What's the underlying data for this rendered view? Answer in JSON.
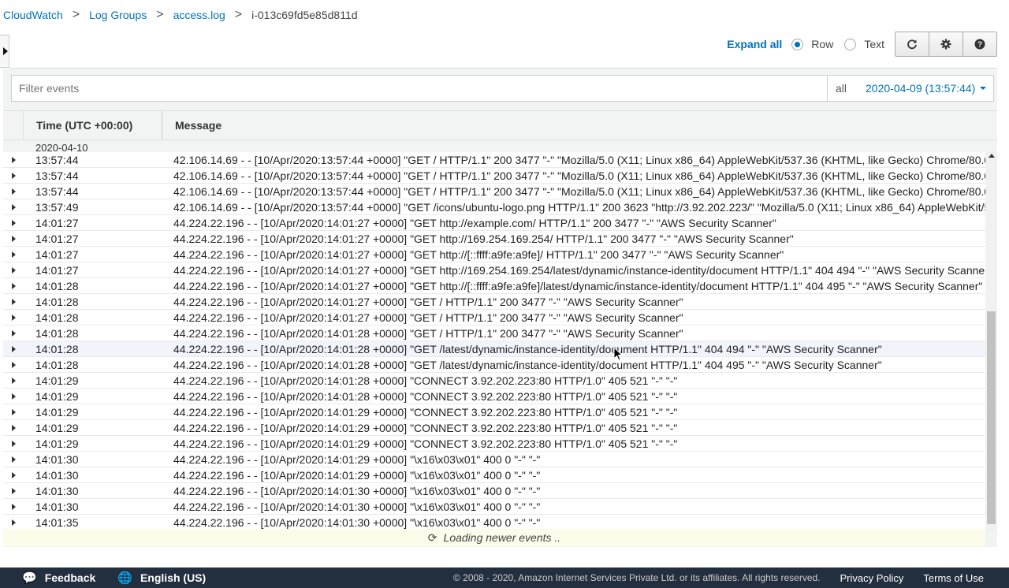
{
  "breadcrumb": {
    "items": [
      "CloudWatch",
      "Log Groups",
      "access.log"
    ],
    "current": "i-013c69fd5e85d811d",
    "separator": ">"
  },
  "toolbar": {
    "expand_all": "Expand all",
    "view_options": [
      "Row",
      "Text"
    ],
    "selected_view": "Row",
    "buttons": [
      "refresh-icon",
      "gear-icon",
      "help-icon"
    ]
  },
  "filter": {
    "placeholder": "Filter events",
    "range_label": "all",
    "range_date": "2020-04-09 (13:57:44)"
  },
  "table": {
    "col_time": "Time (UTC +00:00)",
    "col_message": "Message",
    "date_group": "2020-04-10",
    "rows": [
      {
        "time": "13:57:44",
        "message": "42.106.14.69 - - [10/Apr/2020:13:57:44 +0000] \"GET / HTTP/1.1\" 200 3477 \"-\" \"Mozilla/5.0 (X11; Linux x86_64) AppleWebKit/537.36 (KHTML, like Gecko) Chrome/80.0"
      },
      {
        "time": "13:57:44",
        "message": "42.106.14.69 - - [10/Apr/2020:13:57:44 +0000] \"GET / HTTP/1.1\" 200 3477 \"-\" \"Mozilla/5.0 (X11; Linux x86_64) AppleWebKit/537.36 (KHTML, like Gecko) Chrome/80.0"
      },
      {
        "time": "13:57:44",
        "message": "42.106.14.69 - - [10/Apr/2020:13:57:44 +0000] \"GET / HTTP/1.1\" 200 3477 \"-\" \"Mozilla/5.0 (X11; Linux x86_64) AppleWebKit/537.36 (KHTML, like Gecko) Chrome/80.0"
      },
      {
        "time": "13:57:49",
        "message": "42.106.14.69 - - [10/Apr/2020:13:57:44 +0000] \"GET /icons/ubuntu-logo.png HTTP/1.1\" 200 3623 \"http://3.92.202.223/\" \"Mozilla/5.0 (X11; Linux x86_64) AppleWebKit/5"
      },
      {
        "time": "14:01:27",
        "message": "44.224.22.196 - - [10/Apr/2020:14:01:27 +0000] \"GET http://example.com/ HTTP/1.1\" 200 3477 \"-\" \"AWS Security Scanner\""
      },
      {
        "time": "14:01:27",
        "message": "44.224.22.196 - - [10/Apr/2020:14:01:27 +0000] \"GET http://169.254.169.254/ HTTP/1.1\" 200 3477 \"-\" \"AWS Security Scanner\""
      },
      {
        "time": "14:01:27",
        "message": "44.224.22.196 - - [10/Apr/2020:14:01:27 +0000] \"GET http://[::ffff:a9fe:a9fe]/ HTTP/1.1\" 200 3477 \"-\" \"AWS Security Scanner\""
      },
      {
        "time": "14:01:27",
        "message": "44.224.22.196 - - [10/Apr/2020:14:01:27 +0000] \"GET http://169.254.169.254/latest/dynamic/instance-identity/document HTTP/1.1\" 404 494 \"-\" \"AWS Security Scanne"
      },
      {
        "time": "14:01:28",
        "message": "44.224.22.196 - - [10/Apr/2020:14:01:27 +0000] \"GET http://[::ffff:a9fe:a9fe]/latest/dynamic/instance-identity/document HTTP/1.1\" 404 495 \"-\" \"AWS Security Scanner\""
      },
      {
        "time": "14:01:28",
        "message": "44.224.22.196 - - [10/Apr/2020:14:01:27 +0000] \"GET / HTTP/1.1\" 200 3477 \"-\" \"AWS Security Scanner\""
      },
      {
        "time": "14:01:28",
        "message": "44.224.22.196 - - [10/Apr/2020:14:01:27 +0000] \"GET / HTTP/1.1\" 200 3477 \"-\" \"AWS Security Scanner\""
      },
      {
        "time": "14:01:28",
        "message": "44.224.22.196 - - [10/Apr/2020:14:01:28 +0000] \"GET / HTTP/1.1\" 200 3477 \"-\" \"AWS Security Scanner\""
      },
      {
        "time": "14:01:28",
        "message": "44.224.22.196 - - [10/Apr/2020:14:01:28 +0000] \"GET /latest/dynamic/instance-identity/document HTTP/1.1\" 404 494 \"-\" \"AWS Security Scanner\""
      },
      {
        "time": "14:01:28",
        "message": "44.224.22.196 - - [10/Apr/2020:14:01:28 +0000] \"GET /latest/dynamic/instance-identity/document HTTP/1.1\" 404 495 \"-\" \"AWS Security Scanner\""
      },
      {
        "time": "14:01:29",
        "message": "44.224.22.196 - - [10/Apr/2020:14:01:28 +0000] \"CONNECT 3.92.202.223:80 HTTP/1.0\" 405 521 \"-\" \"-\""
      },
      {
        "time": "14:01:29",
        "message": "44.224.22.196 - - [10/Apr/2020:14:01:28 +0000] \"CONNECT 3.92.202.223:80 HTTP/1.0\" 405 521 \"-\" \"-\""
      },
      {
        "time": "14:01:29",
        "message": "44.224.22.196 - - [10/Apr/2020:14:01:29 +0000] \"CONNECT 3.92.202.223:80 HTTP/1.0\" 405 521 \"-\" \"-\""
      },
      {
        "time": "14:01:29",
        "message": "44.224.22.196 - - [10/Apr/2020:14:01:29 +0000] \"CONNECT 3.92.202.223:80 HTTP/1.0\" 405 521 \"-\" \"-\""
      },
      {
        "time": "14:01:29",
        "message": "44.224.22.196 - - [10/Apr/2020:14:01:29 +0000] \"CONNECT 3.92.202.223:80 HTTP/1.0\" 405 521 \"-\" \"-\""
      },
      {
        "time": "14:01:30",
        "message": "44.224.22.196 - - [10/Apr/2020:14:01:29 +0000] \"\\x16\\x03\\x01\" 400 0 \"-\" \"-\""
      },
      {
        "time": "14:01:30",
        "message": "44.224.22.196 - - [10/Apr/2020:14:01:29 +0000] \"\\x16\\x03\\x01\" 400 0 \"-\" \"-\""
      },
      {
        "time": "14:01:30",
        "message": "44.224.22.196 - - [10/Apr/2020:14:01:30 +0000] \"\\x16\\x03\\x01\" 400 0 \"-\" \"-\""
      },
      {
        "time": "14:01:30",
        "message": "44.224.22.196 - - [10/Apr/2020:14:01:30 +0000] \"\\x16\\x03\\x01\" 400 0 \"-\" \"-\""
      },
      {
        "time": "14:01:35",
        "message": "44.224.22.196 - - [10/Apr/2020:14:01:30 +0000] \"\\x16\\x03\\x01\" 400 0 \"-\" \"-\""
      }
    ],
    "highlighted_row": 12,
    "loading_text": "Loading newer events .."
  },
  "footer": {
    "feedback": "Feedback",
    "language": "English (US)",
    "copyright": "© 2008 - 2020, Amazon Internet Services Private Ltd. or its affiliates. All rights reserved.",
    "privacy": "Privacy Policy",
    "terms": "Terms of Use"
  },
  "colors": {
    "link": "#0073bb",
    "footer_bg": "#232f3e",
    "loading_bg": "#fdfbe9"
  }
}
